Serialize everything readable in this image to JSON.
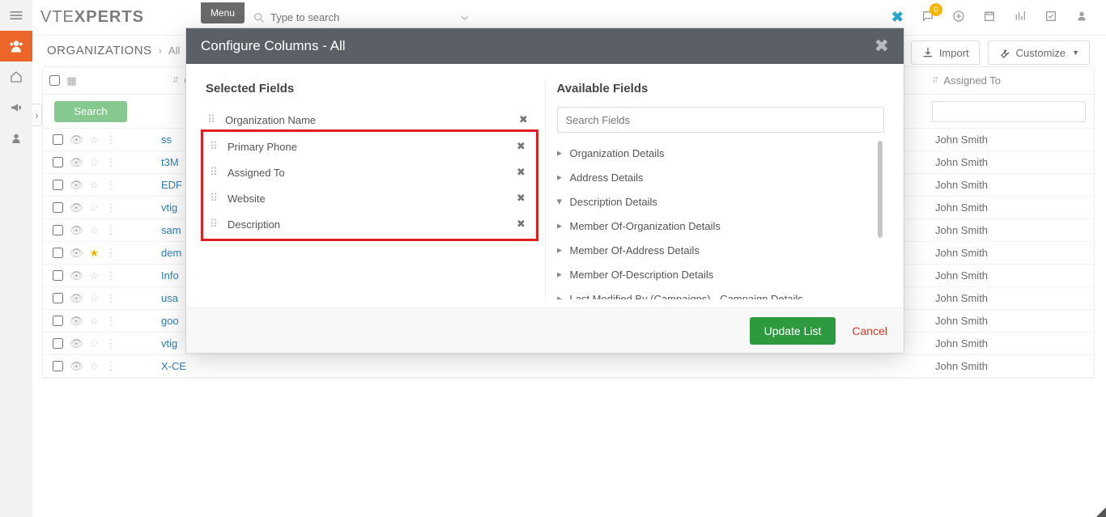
{
  "header": {
    "logo_thin": "VTE",
    "logo_bold": "XPERTS",
    "menu_label": "Menu",
    "search_placeholder": "Type to search",
    "notification_count": "0"
  },
  "breadcrumb": {
    "module": "ORGANIZATIONS",
    "filter": "All"
  },
  "toolbar": {
    "import_label": "Import",
    "customize_label": "Customize"
  },
  "list": {
    "col_org": "Organization Name",
    "col_assigned": "Assigned To",
    "search_btn": "Search",
    "rows": [
      {
        "name": "ss",
        "assigned": "John Smith",
        "starred": false
      },
      {
        "name": "t3M",
        "assigned": "John Smith",
        "starred": false
      },
      {
        "name": "EDF",
        "assigned": "John Smith",
        "starred": false
      },
      {
        "name": "vtig",
        "assigned": "John Smith",
        "starred": false
      },
      {
        "name": "sam",
        "assigned": "John Smith",
        "starred": false
      },
      {
        "name": "dem",
        "assigned": "John Smith",
        "starred": true
      },
      {
        "name": "Info",
        "assigned": "John Smith",
        "starred": false
      },
      {
        "name": "usa",
        "assigned": "John Smith",
        "starred": false
      },
      {
        "name": "goo",
        "assigned": "John Smith",
        "starred": false
      },
      {
        "name": "vtig",
        "assigned": "John Smith",
        "starred": false
      },
      {
        "name": "X-CE",
        "assigned": "John Smith",
        "starred": false
      }
    ]
  },
  "modal": {
    "title": "Configure Columns - All",
    "selected_header": "Selected Fields",
    "available_header": "Available Fields",
    "search_fields_placeholder": "Search Fields",
    "selected": [
      "Organization Name",
      "Primary Phone",
      "Assigned To",
      "Website",
      "Description"
    ],
    "available": [
      {
        "label": "Organization Details",
        "expanded": false
      },
      {
        "label": "Address Details",
        "expanded": false
      },
      {
        "label": "Description Details",
        "expanded": true
      },
      {
        "label": "Member Of-Organization Details",
        "expanded": false
      },
      {
        "label": "Member Of-Address Details",
        "expanded": false
      },
      {
        "label": "Member Of-Description Details",
        "expanded": false
      },
      {
        "label": "Last Modified By (Campaigns) - Campaign Details",
        "expanded": false
      }
    ],
    "update_label": "Update List",
    "cancel_label": "Cancel"
  }
}
